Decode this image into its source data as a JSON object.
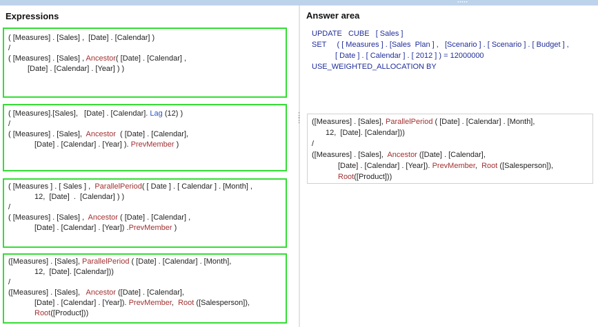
{
  "headings": {
    "expressions": "Expressions",
    "answer_area": "Answer area"
  },
  "expressions": [
    {
      "l1": "( [Measures] . [Sales] ,  [Date] . [Calendar] )",
      "l2": "/",
      "l3a": "( [Measures] . [Sales] , ",
      "l3fn": "Ancestor",
      "l3b": "( [Date] . [Calendar] ,",
      "l4": "[Date] . [Calendar] . [Year] ) )"
    },
    {
      "l1a": "( [Measures].[Sales],   [Date] . [Calendar]. ",
      "l1fn": "Lag",
      "l1b": " (12) )",
      "l2": "/",
      "l3a": "( [Measures] . [Sales],  ",
      "l3fn": "Ancestor",
      "l3b": "  ( [Date] . [Calendar],",
      "l4a": "[Date] . [Calendar] . [Year] ). ",
      "l4fn": "PrevMember",
      "l4b": " )"
    },
    {
      "l1a": "( [Measures ] . [ Sales ] ,  ",
      "l1fn": "ParallelPeriod",
      "l1b": "( [ Date ] . [ Calendar ] . [Month] ,",
      "l2": "12,  [Date]  .  [Calendar] ) )",
      "l3": "/",
      "l4a": "( [Measures] . [Sales] ,  ",
      "l4fn": "Ancestor",
      "l4b": " ( [Date] . [Calendar] ,",
      "l5a": "[Date] . [Calendar] . [Year]) .",
      "l5fn": "PrevMember",
      "l5b": " )"
    },
    {
      "l1a": "([Measures] . [Sales], ",
      "l1fn": "ParallelPeriod",
      "l1b": " ( [Date] . [Calendar] . [Month],",
      "l2": "12,  [Date]. [Calendar]))",
      "l3": "/",
      "l4a": "([Measures] . [Sales],   ",
      "l4fn": "Ancestor",
      "l4b": " ([Date] . [Calendar],",
      "l5a": "[Date] . [Calendar] . [Year]). ",
      "l5fn": "PrevMember",
      "l5b": ",  ",
      "l5fn2": "Root",
      "l5c": " ([Salesperson]),",
      "l6fn": "Root",
      "l6b": "([Product]))"
    }
  ],
  "answer": {
    "code": {
      "l1": "UPDATE   CUBE   [ Sales ]",
      "l2": "SET     ( [ Measures ] . [Sales  Plan ] ,   [Scenario ] . [ Scenario ] . [ Budget ] ,",
      "l3": "[ Date ] . [ Calendar ] . [ 2012 ] ) = 12000000",
      "l4": "USE_WEIGHTED_ALLOCATION BY"
    },
    "dropped": {
      "l1a": "([Measures] . [Sales], ",
      "l1fn": "ParallelPeriod",
      "l1b": " ( [Date] . [Calendar] . [Month],",
      "l2": "12,  [Date]. [Calendar]))",
      "l3": "/",
      "l4a": "([Measures] . [Sales],  ",
      "l4fn": "Ancestor",
      "l4b": " ([Date] . [Calendar],",
      "l5a": "[Date] . [Calendar] . [Year]). ",
      "l5fn": "PrevMember",
      "l5b": ",  ",
      "l5fn2": "Root",
      "l5c": " ([Salesperson]),",
      "l6fn": "Root",
      "l6b": "([Product]))"
    }
  },
  "colors": {
    "highlight": "#33dd33",
    "function": "#a33030",
    "keyword": "#2a52be",
    "code": "#1f2d9a"
  }
}
